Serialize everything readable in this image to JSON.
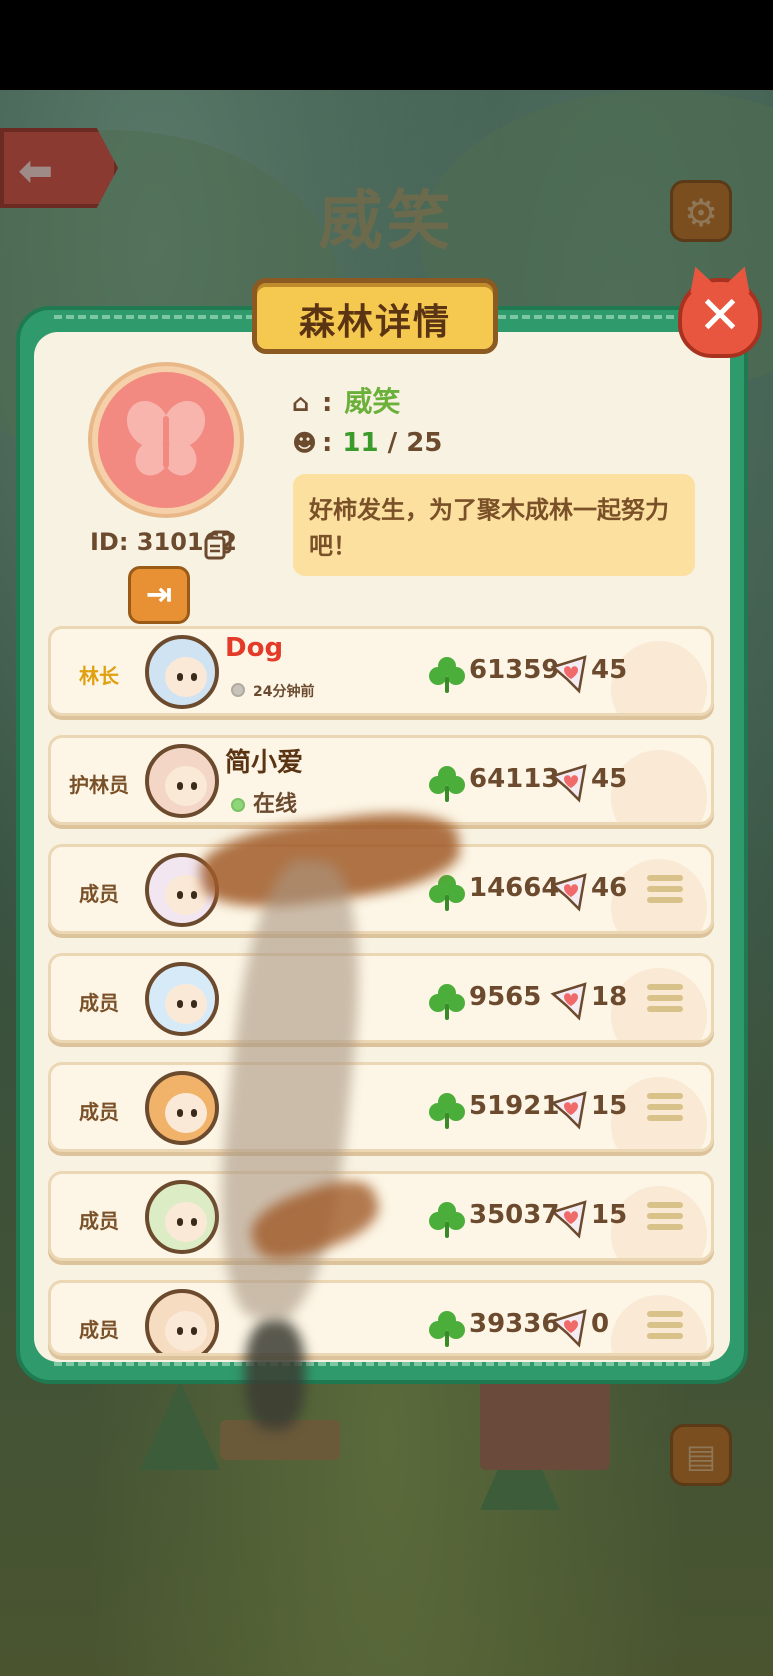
{
  "background": {
    "forest_title": "威笑",
    "back_icon": "back-arrow-icon",
    "settings_icon": "gear-icon",
    "profile_icon": "profile-card-icon"
  },
  "dialog": {
    "title": "森林详情",
    "close_label": "✕",
    "forest": {
      "name": "威笑",
      "id_label": "ID: 310162",
      "member_count": "11",
      "member_capacity": "/ 25",
      "motto": "好柿发生，为了聚木成林一起努力吧！"
    },
    "members": [
      {
        "role": "林长",
        "name": "Dog",
        "status": "24分钟前",
        "score": "61359",
        "likes": "45",
        "online": false,
        "has_menu": false
      },
      {
        "role": "护林员",
        "name": "简小爱",
        "status": "在线",
        "score": "64113",
        "likes": "45",
        "online": true,
        "has_menu": false
      },
      {
        "role": "成员",
        "name": "",
        "status": "",
        "score": "14664",
        "likes": "46",
        "online": false,
        "has_menu": true
      },
      {
        "role": "成员",
        "name": "",
        "status": "",
        "score": "9565",
        "likes": "18",
        "online": false,
        "has_menu": true
      },
      {
        "role": "成员",
        "name": "",
        "status": "",
        "score": "51921",
        "likes": "15",
        "online": false,
        "has_menu": true
      },
      {
        "role": "成员",
        "name": "",
        "status": "",
        "score": "35037",
        "likes": "15",
        "online": false,
        "has_menu": true
      },
      {
        "role": "成员",
        "name": "",
        "status": "",
        "score": "39336",
        "likes": "0",
        "online": false,
        "has_menu": true
      }
    ]
  },
  "colors": {
    "dialog_border": "#2f9a6c",
    "panel": "#f8f2e2",
    "title_plate": "#f5c84f",
    "close": "#e8563f",
    "leader_name": "#e33a2a",
    "clover": "#4cae3a",
    "heart": "#f06a6a"
  }
}
